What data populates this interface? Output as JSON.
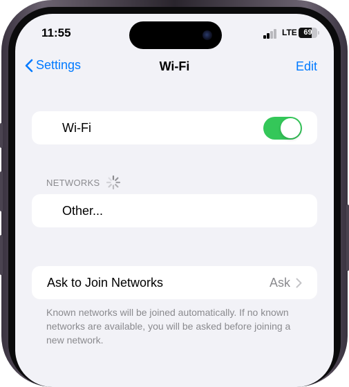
{
  "status_bar": {
    "time": "11:55",
    "network": "LTE",
    "battery": "69",
    "battery_level": 0.69
  },
  "nav": {
    "back_label": "Settings",
    "title": "Wi-Fi",
    "edit_label": "Edit"
  },
  "wifi_cell": {
    "label": "Wi-Fi",
    "toggle_on": true
  },
  "networks": {
    "header": "NETWORKS",
    "other_label": "Other..."
  },
  "ask_to_join": {
    "label": "Ask to Join Networks",
    "value": "Ask",
    "footer": "Known networks will be joined automatically. If no known networks are available, you will be asked before joining a new network."
  },
  "colors": {
    "accent": "#007aff",
    "toggle_on": "#34c759",
    "background": "#f2f2f7",
    "secondary_text": "#8a8a8e"
  },
  "icons": {
    "back": "chevron-left-icon",
    "spinner": "activity-spinner-icon",
    "detail": "chevron-right-icon"
  }
}
